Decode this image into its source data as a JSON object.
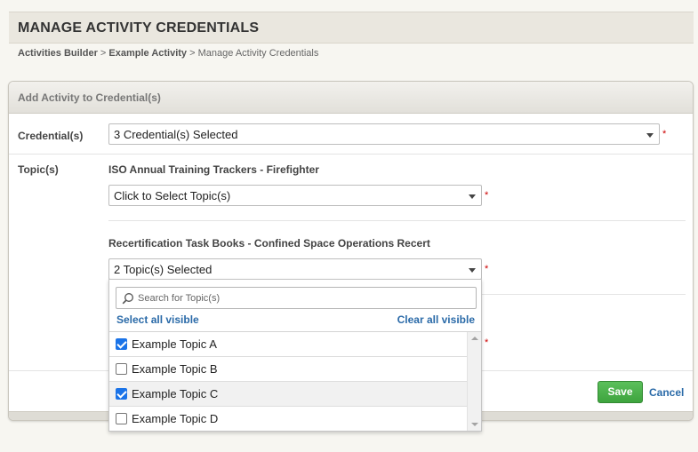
{
  "page": {
    "title": "MANAGE ACTIVITY CREDENTIALS",
    "breadcrumb": [
      "Activities Builder",
      "Example Activity",
      "Manage Activity Credentials"
    ],
    "breadcrumb_separator": ">"
  },
  "panel": {
    "title": "Add Activity to Credential(s)",
    "credentials_label": "Credential(s)",
    "credentials_value": "3 Credential(s) Selected",
    "topics_label": "Topic(s)",
    "required_marker": "*"
  },
  "topic_groups": [
    {
      "title": "ISO Annual Training Trackers - Firefighter",
      "value": "Click to Select Topic(s)"
    },
    {
      "title": "Recertification Task Books - Confined Space Operations Recert",
      "value": "2 Topic(s) Selected"
    }
  ],
  "dropdown": {
    "search_placeholder": "Search for Topic(s)",
    "select_all": "Select all visible",
    "clear_all": "Clear all visible",
    "options": [
      {
        "label": "Example Topic A",
        "checked": true
      },
      {
        "label": "Example Topic B",
        "checked": false
      },
      {
        "label": "Example Topic C",
        "checked": true
      },
      {
        "label": "Example Topic D",
        "checked": false
      }
    ]
  },
  "actions": {
    "save": "Save",
    "cancel": "Cancel"
  },
  "colors": {
    "save_green": "#3ea43e",
    "link_blue": "#2a6aa8",
    "required_red": "#cc0000",
    "checkbox_blue": "#1a73e8"
  }
}
